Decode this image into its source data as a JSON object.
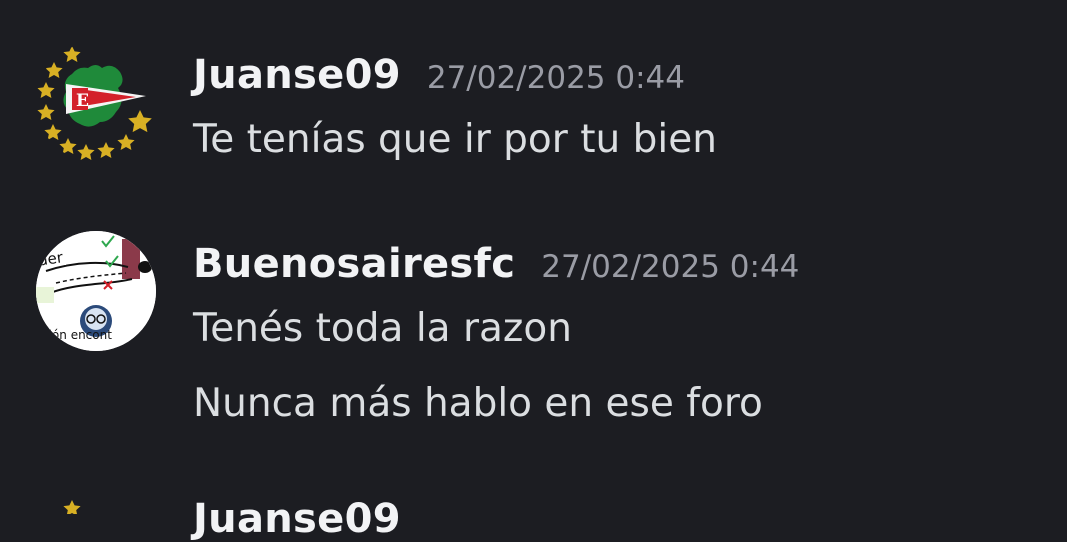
{
  "messages": [
    {
      "username": "Juanse09",
      "timestamp": "27/02/2025 0:44",
      "lines": [
        "Te tenías que ir por tu bien"
      ],
      "avatar": {
        "icon": "estudiantes-crest-icon",
        "letter": "E"
      }
    },
    {
      "username": "Buenosairesfc",
      "timestamp": "27/02/2025 0:44",
      "lines": [
        "Tenés toda la razon",
        "Nunca más hablo en ese foro"
      ],
      "avatar": {
        "icon": "meme-collage-icon",
        "caption": "ción encont",
        "top_text": "der"
      }
    },
    {
      "username": "Juanse09"
    }
  ],
  "colors": {
    "background": "#1c1d22",
    "username": "#f2f3f5",
    "timestamp": "#9a9ca5",
    "message_text": "#dbdee1"
  }
}
